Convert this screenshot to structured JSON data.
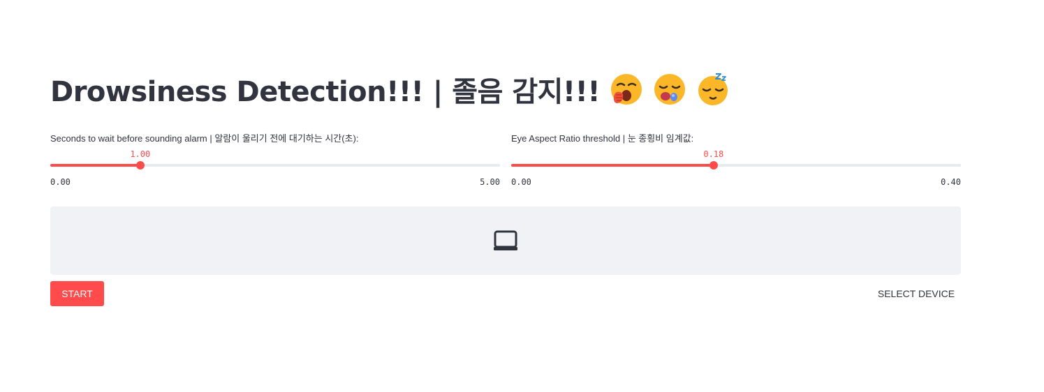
{
  "header": {
    "title": "Drowsiness Detection!!! | 졸음 감지!!!",
    "emoji_icons": [
      "yawning-face-icon",
      "sleepy-face-icon",
      "sleeping-face-icon"
    ]
  },
  "sliders": [
    {
      "label": "Seconds to wait before sounding alarm | 알람이 울리기 전에 대기하는 시간(초):",
      "value": 1.0,
      "value_text": "1.00",
      "min": 0.0,
      "max": 5.0,
      "min_text": "0.00",
      "max_text": "5.00"
    },
    {
      "label": "Eye Aspect Ratio threshold | 눈 종횡비 임계값:",
      "value": 0.18,
      "value_text": "0.18",
      "min": 0.0,
      "max": 0.4,
      "min_text": "0.00",
      "max_text": "0.40"
    }
  ],
  "video": {
    "icon": "video-display-icon"
  },
  "controls": {
    "start_label": "START",
    "select_device_label": "SELECT DEVICE"
  },
  "colors": {
    "accent": "#ff4b4b",
    "text": "#31333f",
    "track": "#e6eaf1",
    "video_bg": "#f0f2f6"
  }
}
